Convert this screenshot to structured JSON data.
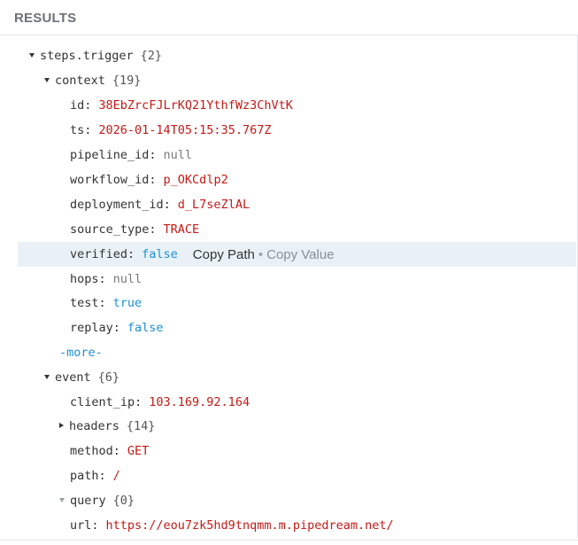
{
  "header": {
    "title": "RESULTS"
  },
  "tree": {
    "root": {
      "key": "steps.trigger",
      "count": "{2}"
    },
    "context": {
      "key": "context",
      "count": "{19}",
      "fields": [
        {
          "key": "id:",
          "value": "38EbZrcFJLrKQ21YthfWz3ChVtK",
          "type": "string"
        },
        {
          "key": "ts:",
          "value": "2026-01-14T05:15:35.767Z",
          "type": "string"
        },
        {
          "key": "pipeline_id:",
          "value": "null",
          "type": "null"
        },
        {
          "key": "workflow_id:",
          "value": "p_OKCdlp2",
          "type": "string"
        },
        {
          "key": "deployment_id:",
          "value": "d_L7seZlAL",
          "type": "string"
        },
        {
          "key": "source_type:",
          "value": "TRACE",
          "type": "string"
        },
        {
          "key": "verified:",
          "value": "false",
          "type": "bool"
        },
        {
          "key": "hops:",
          "value": "null",
          "type": "null"
        },
        {
          "key": "test:",
          "value": "true",
          "type": "bool"
        },
        {
          "key": "replay:",
          "value": "false",
          "type": "bool"
        }
      ],
      "more_label": "-more-"
    },
    "event": {
      "key": "event",
      "count": "{6}",
      "client_ip": {
        "key": "client_ip:",
        "value": "103.169.92.164"
      },
      "headers": {
        "key": "headers",
        "count": "{14}"
      },
      "method": {
        "key": "method:",
        "value": "GET"
      },
      "path": {
        "key": "path:",
        "value": "/"
      },
      "query": {
        "key": "query",
        "count": "{0}"
      },
      "url": {
        "key": "url:",
        "value": "https://eou7zk5hd9tnqmm.m.pipedream.net/"
      }
    }
  },
  "hover_actions": {
    "copy_path": "Copy Path",
    "separator": "•",
    "copy_value": "Copy Value"
  },
  "colors": {
    "string": "#c41a16",
    "bool": "#1e90d6",
    "null": "#7a7a7a",
    "highlight": "#e9f1f6"
  }
}
